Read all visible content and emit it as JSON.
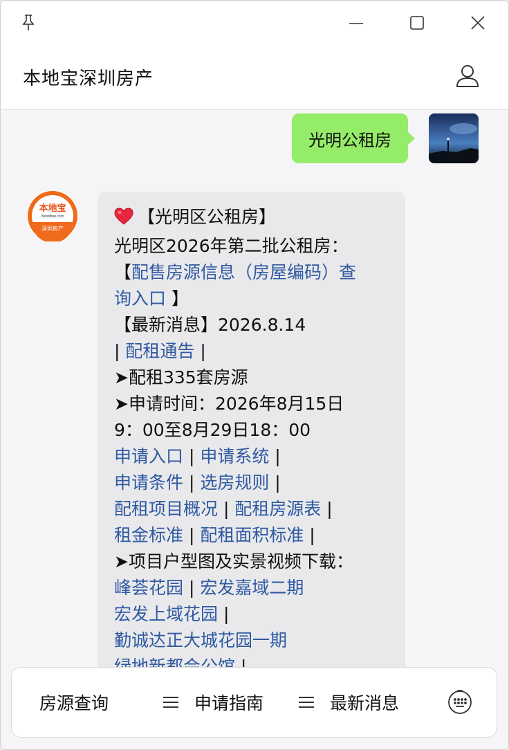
{
  "app": {
    "title": "本地宝深圳房产"
  },
  "chat": {
    "user_message": "光明公租房",
    "bot_lines": [
      {
        "parts": [
          {
            "t": "【光明区公租房】",
            "link": false
          }
        ],
        "heart": true
      },
      {
        "parts": [
          {
            "t": "光明区2026年第二批公租房：",
            "link": false
          }
        ]
      },
      {
        "parts": [
          {
            "t": "【",
            "link": false
          },
          {
            "t": "配售房源信息（房屋编码）查",
            "link": true
          }
        ]
      },
      {
        "parts": [
          {
            "t": "询入口",
            "link": true
          },
          {
            "t": " 】",
            "link": false
          }
        ]
      },
      {
        "parts": [
          {
            "t": "【最新消息】2026.8.14",
            "link": false
          }
        ]
      },
      {
        "parts": [
          {
            "t": "| ",
            "link": false
          },
          {
            "t": "配租通告",
            "link": true
          },
          {
            "t": " |",
            "link": false
          }
        ]
      },
      {
        "parts": [
          {
            "t": "➤配租335套房源",
            "link": false
          }
        ]
      },
      {
        "parts": [
          {
            "t": "➤申请时间：2026年8月15日",
            "link": false
          }
        ]
      },
      {
        "parts": [
          {
            "t": "9：00至8月29日18：00",
            "link": false
          }
        ]
      },
      {
        "parts": [
          {
            "t": "申请入口",
            "link": true
          },
          {
            "t": " | ",
            "link": false
          },
          {
            "t": "申请系统",
            "link": true
          },
          {
            "t": " |",
            "link": false
          }
        ]
      },
      {
        "parts": [
          {
            "t": "申请条件",
            "link": true
          },
          {
            "t": " | ",
            "link": false
          },
          {
            "t": "选房规则",
            "link": true
          },
          {
            "t": " |",
            "link": false
          }
        ]
      },
      {
        "parts": [
          {
            "t": "配租项目概况",
            "link": true
          },
          {
            "t": " | ",
            "link": false
          },
          {
            "t": "配租房源表",
            "link": true
          },
          {
            "t": " |",
            "link": false
          }
        ]
      },
      {
        "parts": [
          {
            "t": "租金标准",
            "link": true
          },
          {
            "t": " | ",
            "link": false
          },
          {
            "t": "配租面积标准",
            "link": true
          },
          {
            "t": " |",
            "link": false
          }
        ]
      },
      {
        "parts": [
          {
            "t": "➤项目户型图及实景视频下载：",
            "link": false
          }
        ]
      },
      {
        "parts": [
          {
            "t": "峰荟花园",
            "link": true
          },
          {
            "t": " | ",
            "link": false
          },
          {
            "t": "宏发嘉域二期",
            "link": true
          }
        ]
      },
      {
        "parts": [
          {
            "t": "宏发上域花园",
            "link": true
          },
          {
            "t": " |",
            "link": false
          }
        ]
      },
      {
        "parts": [
          {
            "t": "勤诚达正大城花园一期",
            "link": true
          }
        ]
      },
      {
        "parts": [
          {
            "t": "绿地新都会公馆",
            "link": true
          },
          {
            "t": " |",
            "link": false
          }
        ]
      }
    ]
  },
  "avatar_badge": {
    "top": "本地宝",
    "mid": "Bendibao.com",
    "bottom": "深圳房产"
  },
  "menu": {
    "item1": "房源查询",
    "item2": "申请指南",
    "item3": "最新消息"
  },
  "colors": {
    "user_bubble": "#95ec69",
    "bot_bubble": "#e9e9ec",
    "link": "#2f5aa1",
    "brand_orange": "#f06a1c"
  }
}
